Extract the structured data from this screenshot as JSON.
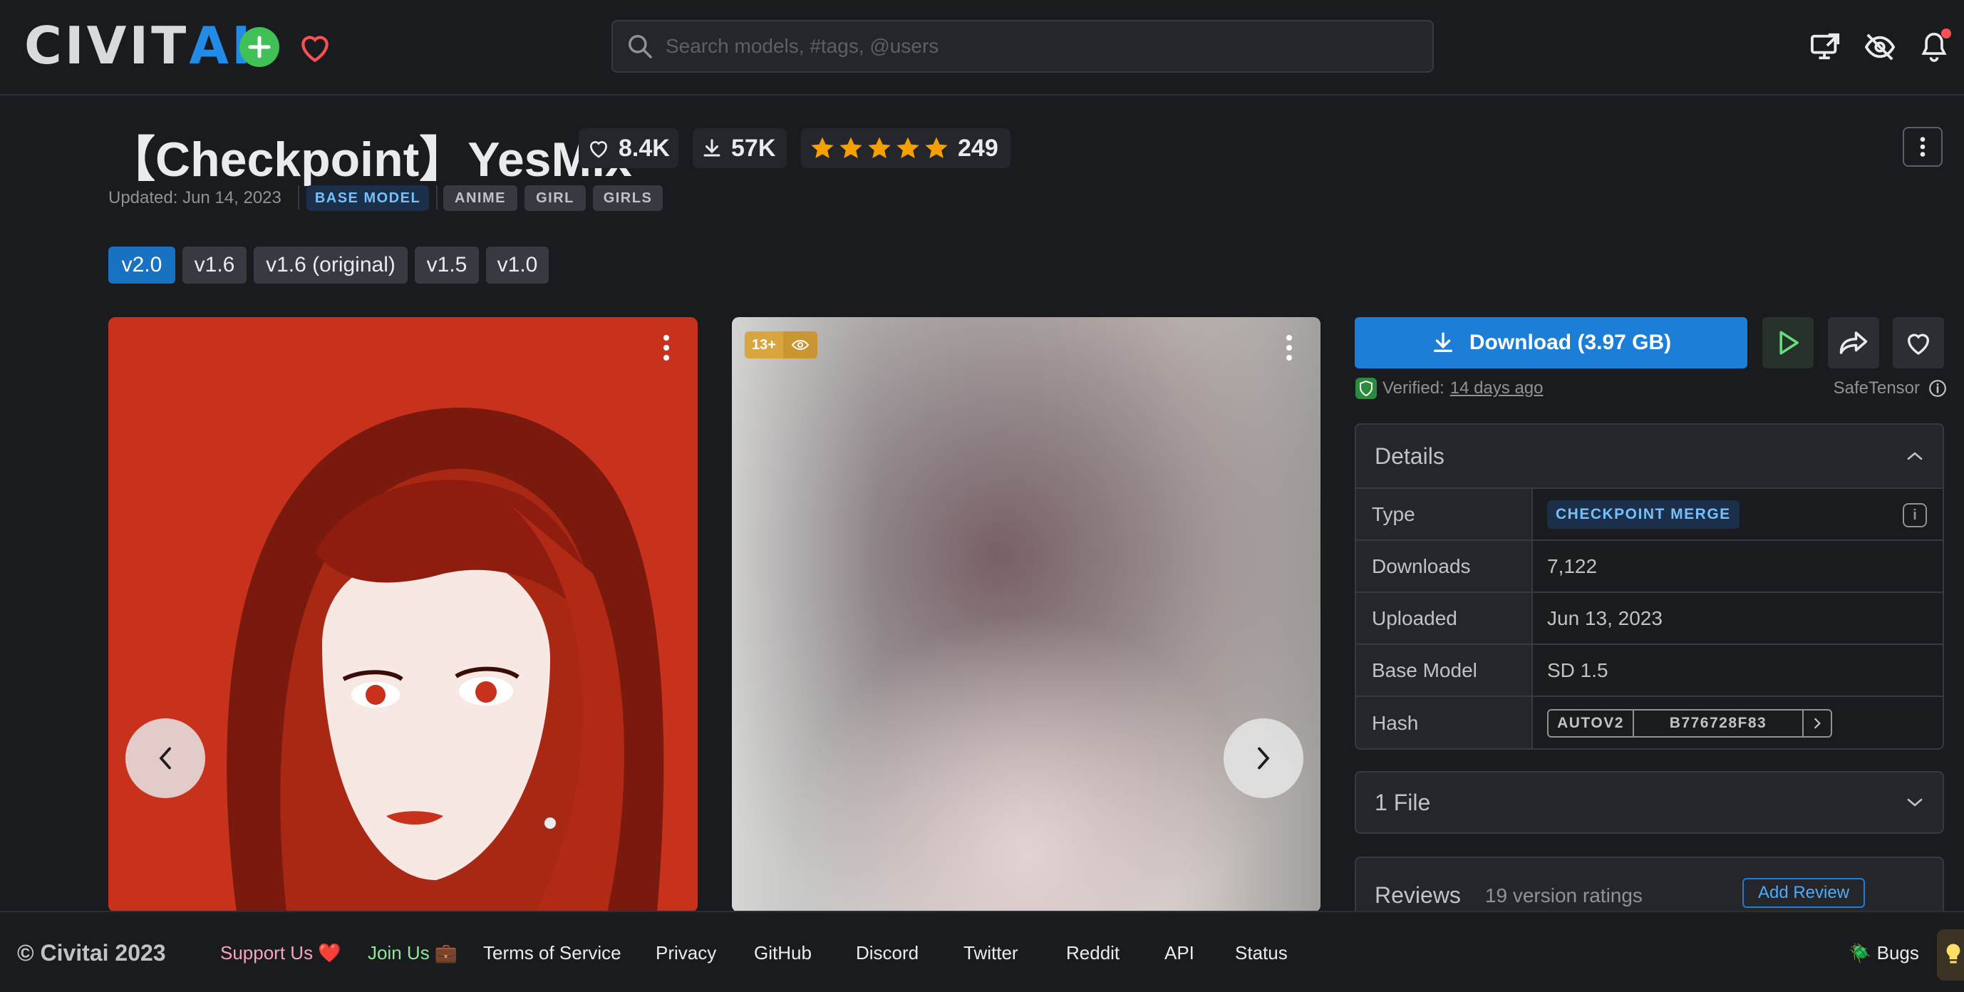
{
  "header": {
    "logo_civ": "CIVIT",
    "logo_ai": "AI",
    "search_placeholder": "Search models, #tags, @users"
  },
  "model": {
    "title": "【Checkpoint】YesMix",
    "likes": "8.4K",
    "downloads": "57K",
    "rating_count": "249",
    "rating_stars": 5,
    "updated": "Updated: Jun 14, 2023",
    "base_badge": "BASE MODEL",
    "tags": [
      "ANIME",
      "GIRL",
      "GIRLS"
    ]
  },
  "versions": [
    {
      "label": "v2.0",
      "active": true
    },
    {
      "label": "v1.6",
      "active": false
    },
    {
      "label": "v1.6 (original)",
      "active": false
    },
    {
      "label": "v1.5",
      "active": false
    },
    {
      "label": "v1.0",
      "active": false
    }
  ],
  "images": {
    "nsfw_label": "13+"
  },
  "sidebar": {
    "download_label": "Download (3.97 GB)",
    "verified_label": "Verified:",
    "verified_when": "14 days ago",
    "safetensor": "SafeTensor",
    "details_title": "Details",
    "details": {
      "type_key": "Type",
      "type_value": "CHECKPOINT MERGE",
      "downloads_key": "Downloads",
      "downloads_value": "7,122",
      "uploaded_key": "Uploaded",
      "uploaded_value": "Jun 13, 2023",
      "base_key": "Base Model",
      "base_value": "SD 1.5",
      "hash_key": "Hash",
      "hash_type": "AUTOV2",
      "hash_value": "B776728F83"
    },
    "files_label": "1 File",
    "reviews_label": "Reviews",
    "reviews_count": "19 version ratings",
    "add_review": "Add Review"
  },
  "footer": {
    "copyright": "© Civitai 2023",
    "support": "Support Us ❤️",
    "join": "Join Us 💼",
    "tos": "Terms of Service",
    "privacy": "Privacy",
    "github": "GitHub",
    "discord": "Discord",
    "twitter": "Twitter",
    "reddit": "Reddit",
    "api": "API",
    "status": "Status",
    "bugs": "🪲 Bugs"
  },
  "colors": {
    "background": "#1a1b1e",
    "accent": "#1c7ed6",
    "star": "#f59f00",
    "brand_green": "#40c057"
  }
}
